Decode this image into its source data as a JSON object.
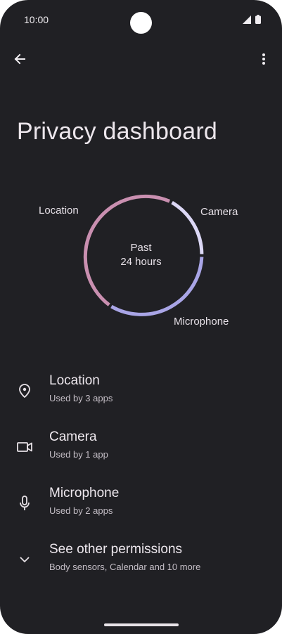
{
  "status_bar": {
    "time": "10:00"
  },
  "page": {
    "title": "Privacy dashboard"
  },
  "chart": {
    "center_line1": "Past",
    "center_line2": "24 hours",
    "labels": {
      "location": "Location",
      "camera": "Camera",
      "microphone": "Microphone"
    },
    "colors": {
      "location": "#c98fb0",
      "camera": "#dcd8f6",
      "microphone": "#a9a5e6"
    }
  },
  "permissions": [
    {
      "title": "Location",
      "subtitle": "Used by 3 apps",
      "icon": "location-pin-icon"
    },
    {
      "title": "Camera",
      "subtitle": "Used by 1 app",
      "icon": "videocam-icon"
    },
    {
      "title": "Microphone",
      "subtitle": "Used by 2 apps",
      "icon": "mic-icon"
    },
    {
      "title": "See other permissions",
      "subtitle": "Body sensors, Calendar and 10 more",
      "icon": "chevron-down-icon"
    }
  ]
}
